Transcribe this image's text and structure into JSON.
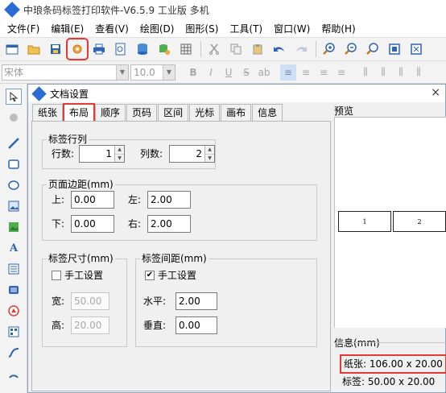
{
  "app": {
    "title": "中琅条码标签打印软件-V6.5.9 工业版 多机"
  },
  "menu": [
    "文件(F)",
    "编辑(E)",
    "查看(V)",
    "绘图(D)",
    "图形(S)",
    "工具(T)",
    "窗口(W)",
    "帮助(H)"
  ],
  "toolbar": {
    "icons": [
      "new-file-icon",
      "open-folder-icon",
      "save-icon",
      "document-settings-icon",
      "print-icon",
      "print-preview-icon",
      "database-icon",
      "database-settings-icon",
      "grid-icon",
      "cut-icon",
      "copy-icon",
      "paste-icon",
      "undo-icon",
      "redo-icon",
      "zoom-in-icon",
      "zoom-out-icon",
      "zoom-fit-icon",
      "zoom-page-icon",
      "zoom-actual-icon"
    ],
    "highlighted": "document-settings-icon"
  },
  "fontbar": {
    "font_name": "宋体",
    "font_size": "10.0",
    "bold": "B",
    "italic": "I",
    "underline": "U",
    "strike": "S"
  },
  "dialog": {
    "title": "文档设置",
    "close": "×",
    "tabs": [
      "纸张",
      "布局",
      "顺序",
      "页码",
      "区间",
      "光标",
      "画布",
      "信息"
    ],
    "active_tab": "布局",
    "layout": {
      "rowcol": {
        "legend": "标签行列",
        "rows_label": "行数:",
        "rows_value": "1",
        "cols_label": "列数:",
        "cols_value": "2"
      },
      "margin": {
        "legend": "页面边距(mm)",
        "top_label": "上:",
        "top_value": "0.00",
        "left_label": "左:",
        "left_value": "2.00",
        "bottom_label": "下:",
        "bottom_value": "0.00",
        "right_label": "右:",
        "right_value": "2.00"
      },
      "size": {
        "legend": "标签尺寸(mm)",
        "manual_label": "手工设置",
        "manual_checked": false,
        "width_label": "宽:",
        "width_value": "50.00",
        "height_label": "高:",
        "height_value": "20.00"
      },
      "gap": {
        "legend": "标签间距(mm)",
        "manual_label": "手工设置",
        "manual_checked": true,
        "h_label": "水平:",
        "h_value": "2.00",
        "v_label": "垂直:",
        "v_value": "0.00"
      }
    },
    "preview": {
      "label": "预览",
      "cells": [
        "1",
        "2"
      ]
    },
    "info": {
      "label": "信息(mm)",
      "paper": "纸张: 106.00 x 20.00",
      "label_size": "标签: 50.00 x 20.00"
    }
  },
  "colors": {
    "highlight": "#e53935",
    "accent": "#2b6cd4"
  }
}
